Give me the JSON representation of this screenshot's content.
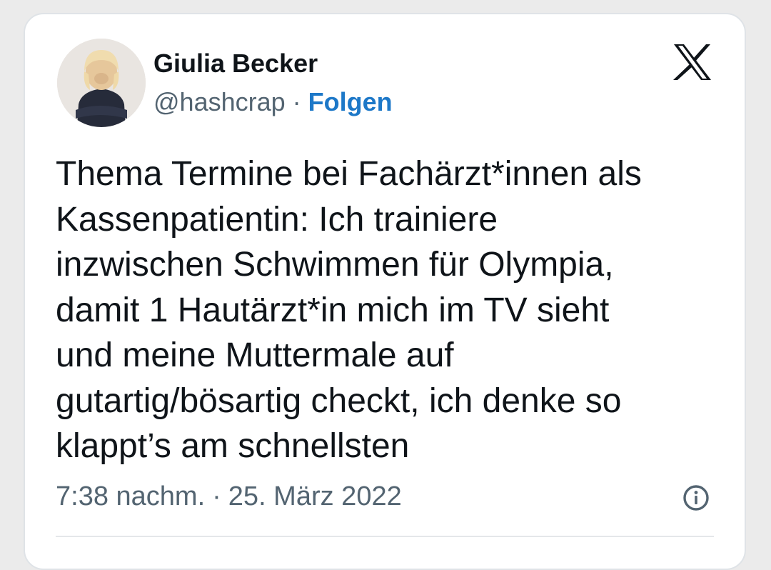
{
  "author": {
    "name": "Giulia Becker",
    "handle": "@hashcrap",
    "separator": "·",
    "follow_label": "Folgen",
    "avatar_icon": "profile-photo"
  },
  "logo_icon": "x-logo-icon",
  "tweet": {
    "text": "Thema Termine bei Fachärzt*innen als\nKassenpatientin: Ich trainiere\ninzwischen Schwimmen für Olympia,\ndamit 1 Hautärzt*in mich im TV sieht\nund meine Muttermale auf\ngutartig/bösartig checkt, ich denke so\nklappt’s am schnellsten",
    "time": "7:38 nachm.",
    "separator": "·",
    "date": "25. März 2022",
    "info_icon": "info-icon"
  },
  "colors": {
    "text": "#0f1419",
    "secondary": "#536471",
    "link": "#1d78c8",
    "background": "#ebebeb",
    "card": "#ffffff"
  }
}
